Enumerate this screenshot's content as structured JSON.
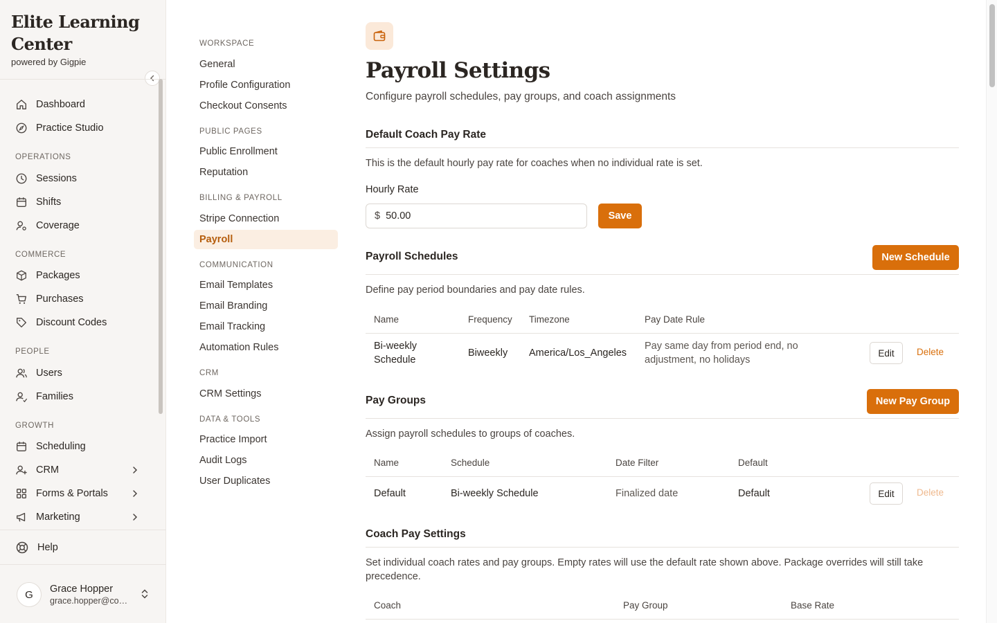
{
  "brand": {
    "title_line1": "Elite Learning",
    "title_line2": "Center",
    "subtitle": "powered by Gigpie"
  },
  "sidebar": {
    "items": [
      {
        "label": "Dashboard",
        "icon": "home-icon"
      },
      {
        "label": "Practice Studio",
        "icon": "compass-icon"
      }
    ],
    "sections": [
      {
        "title": "OPERATIONS",
        "items": [
          {
            "label": "Sessions",
            "icon": "clock-icon"
          },
          {
            "label": "Shifts",
            "icon": "calendar-icon"
          },
          {
            "label": "Coverage",
            "icon": "user-gear-icon"
          }
        ]
      },
      {
        "title": "COMMERCE",
        "items": [
          {
            "label": "Packages",
            "icon": "package-icon"
          },
          {
            "label": "Purchases",
            "icon": "cart-icon"
          },
          {
            "label": "Discount Codes",
            "icon": "tag-icon"
          }
        ]
      },
      {
        "title": "PEOPLE",
        "items": [
          {
            "label": "Users",
            "icon": "users-icon"
          },
          {
            "label": "Families",
            "icon": "family-icon"
          }
        ]
      },
      {
        "title": "GROWTH",
        "items": [
          {
            "label": "Scheduling",
            "icon": "calendar-icon"
          },
          {
            "label": "CRM",
            "icon": "user-plus-icon"
          },
          {
            "label": "Forms & Portals",
            "icon": "grid-icon"
          },
          {
            "label": "Marketing",
            "icon": "megaphone-icon"
          }
        ]
      }
    ],
    "help": "Help",
    "user": {
      "initial": "G",
      "name": "Grace Hopper",
      "email": "grace.hopper@company.com"
    }
  },
  "settings_nav": {
    "sections": [
      {
        "title": "WORKSPACE",
        "items": [
          "General",
          "Profile Configuration",
          "Checkout Consents"
        ]
      },
      {
        "title": "PUBLIC PAGES",
        "items": [
          "Public Enrollment",
          "Reputation"
        ]
      },
      {
        "title": "BILLING & PAYROLL",
        "items": [
          "Stripe Connection",
          "Payroll"
        ]
      },
      {
        "title": "COMMUNICATION",
        "items": [
          "Email Templates",
          "Email Branding",
          "Email Tracking",
          "Automation Rules"
        ]
      },
      {
        "title": "CRM",
        "items": [
          "CRM Settings"
        ]
      },
      {
        "title": "DATA & TOOLS",
        "items": [
          "Practice Import",
          "Audit Logs",
          "User Duplicates"
        ]
      }
    ],
    "active": "Payroll"
  },
  "page": {
    "title": "Payroll Settings",
    "subtitle": "Configure payroll schedules, pay groups, and coach assignments",
    "icon": "wallet-icon"
  },
  "default_rate": {
    "title": "Default Coach Pay Rate",
    "description": "This is the default hourly pay rate for coaches when no individual rate is set.",
    "label": "Hourly Rate",
    "currency": "$",
    "value": "50.00",
    "save_label": "Save"
  },
  "schedules": {
    "title": "Payroll Schedules",
    "new_label": "New Schedule",
    "description": "Define pay period boundaries and pay date rules.",
    "columns": [
      "Name",
      "Frequency",
      "Timezone",
      "Pay Date Rule"
    ],
    "rows": [
      {
        "name_line1": "Bi-weekly",
        "name_line2": "Schedule",
        "frequency": "Biweekly",
        "timezone": "America/Los_Angeles",
        "rule_line1": "Pay same day from period end, no",
        "rule_line2": "adjustment, no holidays",
        "edit": "Edit",
        "delete": "Delete"
      }
    ]
  },
  "pay_groups": {
    "title": "Pay Groups",
    "new_label": "New Pay Group",
    "description": "Assign payroll schedules to groups of coaches.",
    "columns": [
      "Name",
      "Schedule",
      "Date Filter",
      "Default"
    ],
    "rows": [
      {
        "name": "Default",
        "schedule": "Bi-weekly Schedule",
        "date_filter": "Finalized date",
        "default": "Default",
        "edit": "Edit",
        "delete": "Delete"
      }
    ]
  },
  "coach_pay": {
    "title": "Coach Pay Settings",
    "description_line1": "Set individual coach rates and pay groups. Empty rates will use the default rate shown above. Package overrides will still take",
    "description_line2": "precedence.",
    "columns": [
      "Coach",
      "Pay Group",
      "Base Rate"
    ]
  },
  "colors": {
    "accent": "#d96f0b",
    "active_bg": "#fbeee2",
    "sidebar_bg": "#f7f5f3"
  }
}
